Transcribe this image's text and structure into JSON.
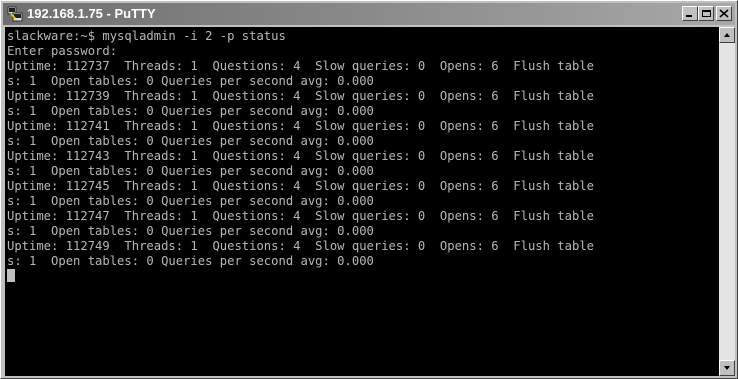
{
  "window": {
    "title": "192.168.1.75 - PuTTY",
    "app_icon": "putty-icon"
  },
  "title_controls": {
    "minimize_icon": "minimize-icon",
    "restore_icon": "restore-icon",
    "close_icon": "close-icon"
  },
  "terminal": {
    "lines": [
      "slackware:~$ mysqladmin -i 2 -p status",
      "Enter password:",
      "Uptime: 112737  Threads: 1  Questions: 4  Slow queries: 0  Opens: 6  Flush table",
      "s: 1  Open tables: 0 Queries per second avg: 0.000",
      "Uptime: 112739  Threads: 1  Questions: 4  Slow queries: 0  Opens: 6  Flush table",
      "s: 1  Open tables: 0 Queries per second avg: 0.000",
      "Uptime: 112741  Threads: 1  Questions: 4  Slow queries: 0  Opens: 6  Flush table",
      "s: 1  Open tables: 0 Queries per second avg: 0.000",
      "Uptime: 112743  Threads: 1  Questions: 4  Slow queries: 0  Opens: 6  Flush table",
      "s: 1  Open tables: 0 Queries per second avg: 0.000",
      "Uptime: 112745  Threads: 1  Questions: 4  Slow queries: 0  Opens: 6  Flush table",
      "s: 1  Open tables: 0 Queries per second avg: 0.000",
      "Uptime: 112747  Threads: 1  Questions: 4  Slow queries: 0  Opens: 6  Flush table",
      "s: 1  Open tables: 0 Queries per second avg: 0.000",
      "Uptime: 112749  Threads: 1  Questions: 4  Slow queries: 0  Opens: 6  Flush table",
      "s: 1  Open tables: 0 Queries per second avg: 0.000"
    ],
    "foreground_color": "#b8b8b8",
    "background_color": "#000000"
  },
  "scrollbar": {
    "up_icon": "scroll-up-arrow-icon",
    "down_icon": "scroll-down-arrow-icon"
  }
}
